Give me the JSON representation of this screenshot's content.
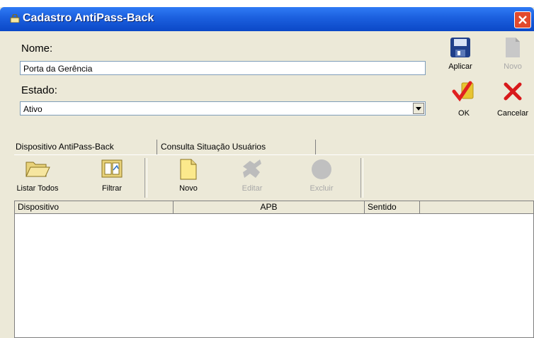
{
  "window": {
    "title": "Cadastro AntiPass-Back"
  },
  "form": {
    "nome_label": "Nome:",
    "nome_value": "Porta da Gerência",
    "estado_label": "Estado:",
    "estado_value": "Ativo"
  },
  "actions": {
    "aplicar": "Aplicar",
    "novo": "Novo",
    "ok": "OK",
    "cancelar": "Cancelar"
  },
  "tabs": [
    {
      "label": "Dispositivo AntiPass-Back",
      "active": true
    },
    {
      "label": "Consulta Situação Usuários",
      "active": false
    }
  ],
  "toolbar": {
    "listar": "Listar Todos",
    "filtrar": "Filtrar",
    "novo": "Novo",
    "editar": "Editar",
    "excluir": "Excluir"
  },
  "grid": {
    "columns": [
      "Dispositivo",
      "APB",
      "Sentido"
    ]
  },
  "colors": {
    "titlebar": "#0b48c7",
    "window": "#ece9d8",
    "close": "#e24a2c"
  }
}
